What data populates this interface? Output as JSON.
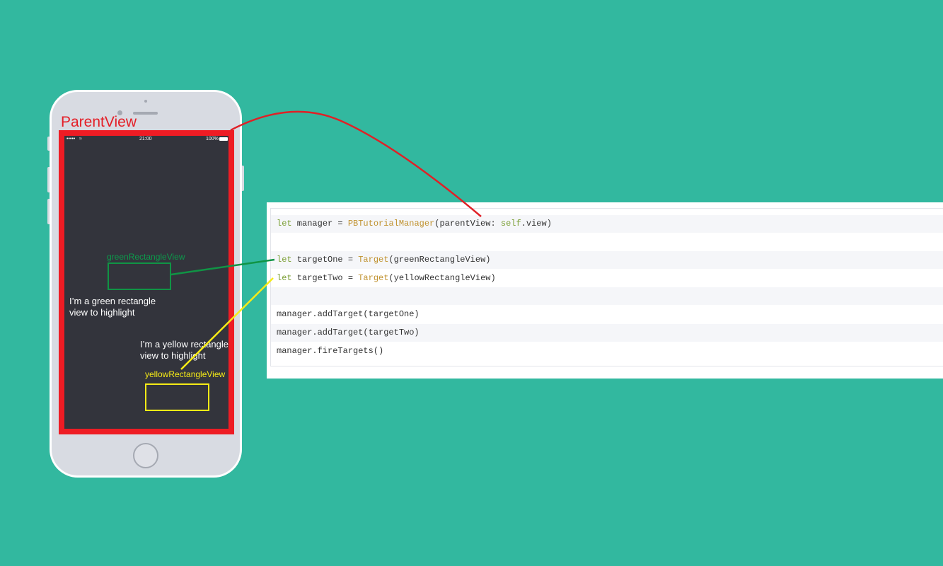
{
  "parent_view": {
    "label": "ParentView"
  },
  "status_bar": {
    "signal": "•••••",
    "time": "21:00",
    "battery": "100%"
  },
  "green_view": {
    "label": "greenRectangleView",
    "caption": "I’m a green rectangle\nview to highlight",
    "color": "#109445"
  },
  "yellow_view": {
    "label": "yellowRectangleView",
    "caption": "I’m a yellow rectangle\nview to highlight",
    "color": "#f6eb16"
  },
  "code": {
    "line1": {
      "kw": "let",
      "a": " manager = ",
      "type": "PBTutorialManager",
      "b": "(parentView: ",
      "kw2": "self",
      "c": ".view)"
    },
    "line2": {
      "kw": "let",
      "a": " targetOne = ",
      "type": "Target",
      "b": "(greenRectangleView)"
    },
    "line3": {
      "kw": "let",
      "a": " targetTwo = ",
      "type": "Target",
      "b": "(yellowRectangleView)"
    },
    "line4": "manager.addTarget(targetOne)",
    "line5": "manager.addTarget(targetTwo)",
    "line6": "manager.fireTargets()"
  },
  "colors": {
    "background": "#32b89f",
    "parent_frame": "#ee1c24",
    "keyword": "#7a9e33",
    "type": "#c0922f"
  }
}
